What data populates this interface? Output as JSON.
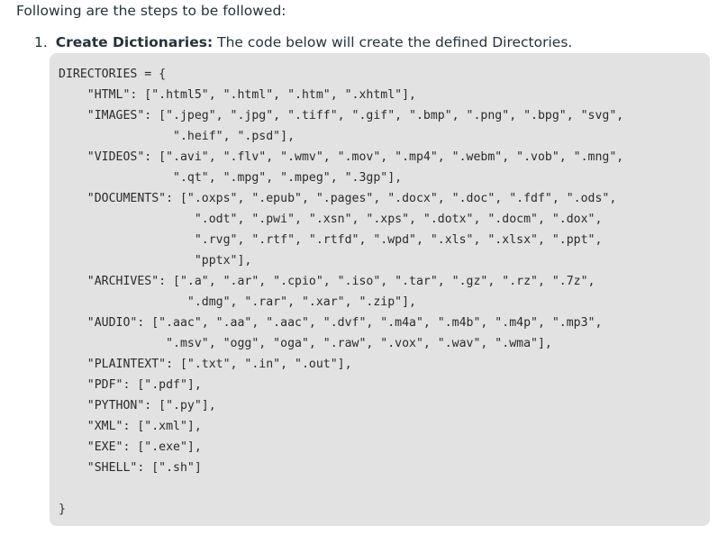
{
  "intro_text": "Following are the steps to be followed:",
  "step": {
    "number": "1.",
    "title": "Create Dictionaries:",
    "description": "The code below will create the defined Directories."
  },
  "code": "DIRECTORIES = {\n    \"HTML\": [\".html5\", \".html\", \".htm\", \".xhtml\"],\n    \"IMAGES\": [\".jpeg\", \".jpg\", \".tiff\", \".gif\", \".bmp\", \".png\", \".bpg\", \"svg\",\n                \".heif\", \".psd\"],\n    \"VIDEOS\": [\".avi\", \".flv\", \".wmv\", \".mov\", \".mp4\", \".webm\", \".vob\", \".mng\",\n                \".qt\", \".mpg\", \".mpeg\", \".3gp\"],\n    \"DOCUMENTS\": [\".oxps\", \".epub\", \".pages\", \".docx\", \".doc\", \".fdf\", \".ods\",\n                   \".odt\", \".pwi\", \".xsn\", \".xps\", \".dotx\", \".docm\", \".dox\",\n                   \".rvg\", \".rtf\", \".rtfd\", \".wpd\", \".xls\", \".xlsx\", \".ppt\",\n                   \"pptx\"],\n    \"ARCHIVES\": [\".a\", \".ar\", \".cpio\", \".iso\", \".tar\", \".gz\", \".rz\", \".7z\",\n                  \".dmg\", \".rar\", \".xar\", \".zip\"],\n    \"AUDIO\": [\".aac\", \".aa\", \".aac\", \".dvf\", \".m4a\", \".m4b\", \".m4p\", \".mp3\",\n               \".msv\", \"ogg\", \"oga\", \".raw\", \".vox\", \".wav\", \".wma\"],\n    \"PLAINTEXT\": [\".txt\", \".in\", \".out\"],\n    \"PDF\": [\".pdf\"],\n    \"PYTHON\": [\".py\"],\n    \"XML\": [\".xml\"],\n    \"EXE\": [\".exe\"],\n    \"SHELL\": [\".sh\"]\n\n}"
}
